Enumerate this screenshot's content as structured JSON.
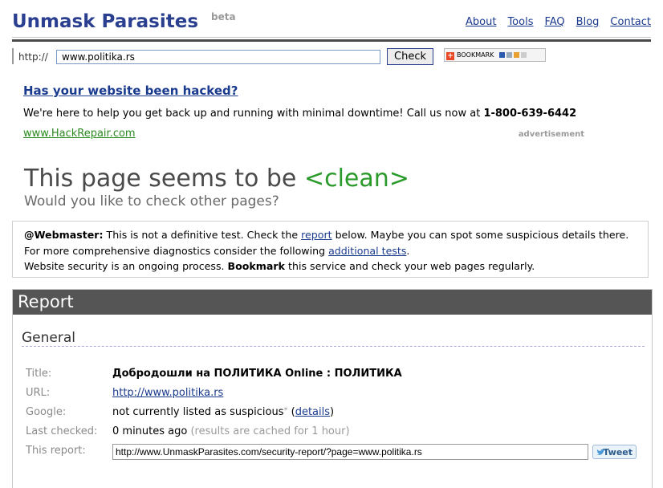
{
  "header": {
    "logo": "Unmask Parasites",
    "beta": "beta",
    "nav": [
      "About",
      "Tools",
      "FAQ",
      "Blog",
      "Contact"
    ]
  },
  "search": {
    "prefix": "http://",
    "value": "www.politika.rs",
    "button": "Check",
    "bookmark_label": "BOOKMARK"
  },
  "ad": {
    "title": "Has your website been hacked?",
    "text": "We're here to help you get back up and running with minimal downtime! Call us now at ",
    "phone": "1-800-639-6442",
    "link": "www.HackRepair.com",
    "label": "advertisement"
  },
  "status": {
    "prefix": "This page seems to be ",
    "result": "<clean>",
    "sub": "Would you like to check other pages?"
  },
  "notice": {
    "line1_bold": "@Webmaster:",
    "line1_a": " This is not a definitive test. Check the ",
    "line1_link": "report",
    "line1_b": " below. Maybe you can spot some suspicious details there.",
    "line2_a": "For more comprehensive diagnostics consider the following ",
    "line2_link": "additional tests",
    "line2_b": ".",
    "line3_a": "Website security is an ongoing process. ",
    "line3_bold": "Bookmark",
    "line3_b": " this service and check your web pages regularly."
  },
  "report": {
    "title": "Report",
    "section": "General",
    "title_label": "Title:",
    "title_value": "Добродошли на ПОЛИТИКА Online : ПОЛИТИКА",
    "url_label": "URL:",
    "url_value": "http://www.politika.rs",
    "google_label": "Google:",
    "google_value": "not currently listed as suspicious",
    "google_star": "*",
    "google_details_open": " (",
    "google_details": "details",
    "google_details_close": ")",
    "checked_label": "Last checked:",
    "checked_value": "0 minutes ago",
    "checked_note": "(results are cached for 1 hour)",
    "this_report_label": "This report:",
    "this_report_value": "http://www.UnmaskParasites.com/security-report/?page=www.politika.rs",
    "tweet": "Tweet"
  },
  "colors": {
    "brand": "#2a3f8f",
    "clean": "#2a9a2a",
    "report_header": "#555555"
  }
}
